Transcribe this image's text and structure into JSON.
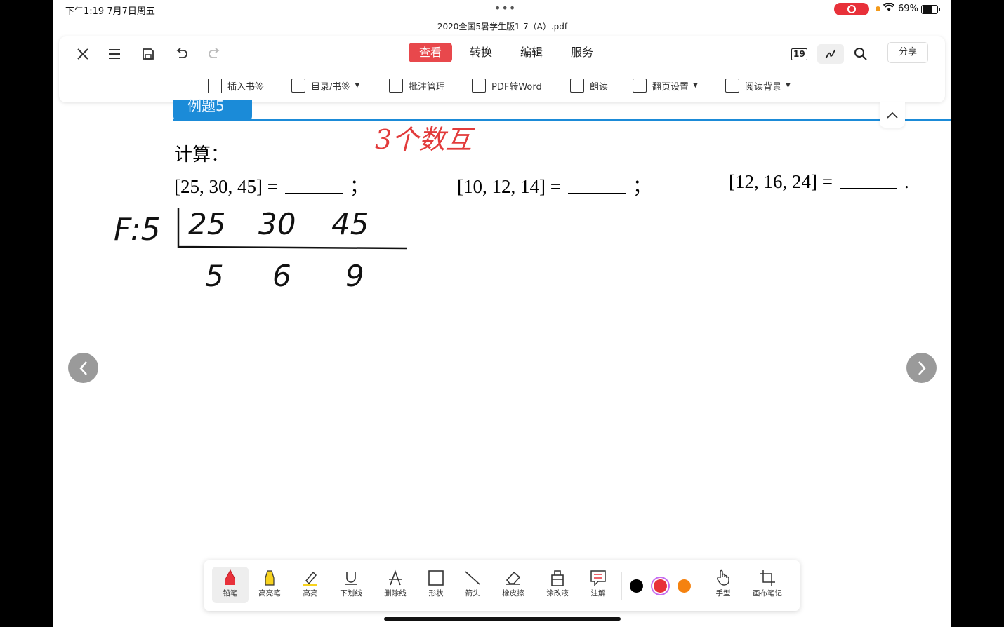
{
  "status_bar": {
    "time": "下午1:19   7月7日周五",
    "battery": "69%"
  },
  "document": {
    "filename": "2020全国5暑学生版1-7（A）.pdf"
  },
  "toolbar": {
    "tabs": [
      "查看",
      "转换",
      "编辑",
      "服务"
    ],
    "active_tab": "查看",
    "page_number": "19",
    "share_label": "分享",
    "sub_tools": [
      {
        "label": "插入书签"
      },
      {
        "label": "目录/书签",
        "dropdown": true
      },
      {
        "label": "批注管理"
      },
      {
        "label": "PDF转Word"
      },
      {
        "label": "朗读"
      },
      {
        "label": "翻页设置",
        "dropdown": true
      },
      {
        "label": "阅读背景",
        "dropdown": true
      }
    ]
  },
  "page_content": {
    "banner": "例题5",
    "calc_label": "计算：",
    "expressions": [
      {
        "text": "[25, 30, 45] =",
        "end": "；"
      },
      {
        "text": "[10, 12, 14] =",
        "end": "；"
      },
      {
        "text": "[12, 16, 24] =",
        "end": "."
      }
    ]
  },
  "annotations": {
    "red_note": "3个数互",
    "division": {
      "label": "F:5",
      "top_row": [
        "25",
        "30",
        "45"
      ],
      "bottom_row": [
        "5",
        "6",
        "9"
      ]
    }
  },
  "bottom_tools": [
    {
      "label": "铅笔",
      "icon": "pencil-icon",
      "active": true
    },
    {
      "label": "高亮笔",
      "icon": "highlighter-pen-icon"
    },
    {
      "label": "高亮",
      "icon": "highlight-icon"
    },
    {
      "label": "下划线",
      "icon": "underline-icon"
    },
    {
      "label": "删除线",
      "icon": "strikethrough-icon"
    },
    {
      "label": "形状",
      "icon": "shape-icon"
    },
    {
      "label": "箭头",
      "icon": "arrow-icon"
    },
    {
      "label": "橡皮擦",
      "icon": "eraser-icon"
    },
    {
      "label": "涂改液",
      "icon": "correction-fluid-icon"
    },
    {
      "label": "注解",
      "icon": "comment-icon"
    },
    {
      "label": "手型",
      "icon": "hand-icon"
    },
    {
      "label": "画布笔记",
      "icon": "canvas-note-icon"
    }
  ],
  "colors": {
    "accent": "#e8484c",
    "banner_blue": "#1b8bd8",
    "swatches": [
      "#000000",
      "#e8313a",
      "#f5820f"
    ]
  }
}
